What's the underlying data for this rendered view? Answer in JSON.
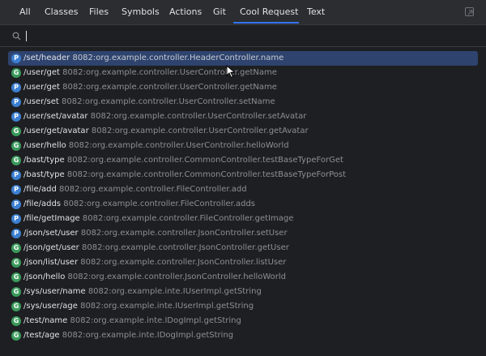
{
  "tabs": [
    {
      "label": "All"
    },
    {
      "label": "Classes"
    },
    {
      "label": "Files"
    },
    {
      "label": "Symbols"
    },
    {
      "label": "Actions"
    },
    {
      "label": "Git"
    },
    {
      "label": "Cool Request"
    },
    {
      "label": "Text"
    }
  ],
  "active_tab": "Cool Request",
  "search": {
    "value": "",
    "placeholder": ""
  },
  "selected_index": 0,
  "colors": {
    "accent": "#3574f0",
    "selection": "#2e436e",
    "post_badge": "#3c7fd1",
    "get_badge": "#3a9a5b"
  },
  "results": [
    {
      "method": "P",
      "path": "/set/header",
      "detail": "8082:org.example.controller.HeaderController.name"
    },
    {
      "method": "G",
      "path": "/user/get",
      "detail": "8082:org.example.controller.UserController.getName"
    },
    {
      "method": "P",
      "path": "/user/get",
      "detail": "8082:org.example.controller.UserController.getName"
    },
    {
      "method": "P",
      "path": "/user/set",
      "detail": "8082:org.example.controller.UserController.setName"
    },
    {
      "method": "P",
      "path": "/user/set/avatar",
      "detail": "8082:org.example.controller.UserController.setAvatar"
    },
    {
      "method": "G",
      "path": "/user/get/avatar",
      "detail": "8082:org.example.controller.UserController.getAvatar"
    },
    {
      "method": "G",
      "path": "/user/hello",
      "detail": "8082:org.example.controller.UserController.helloWorld"
    },
    {
      "method": "G",
      "path": "/bast/type",
      "detail": "8082:org.example.controller.CommonController.testBaseTypeForGet"
    },
    {
      "method": "P",
      "path": "/bast/type",
      "detail": "8082:org.example.controller.CommonController.testBaseTypeForPost"
    },
    {
      "method": "P",
      "path": "/file/add",
      "detail": "8082:org.example.controller.FileController.add"
    },
    {
      "method": "P",
      "path": "/file/adds",
      "detail": "8082:org.example.controller.FileController.adds"
    },
    {
      "method": "P",
      "path": "/file/getImage",
      "detail": "8082:org.example.controller.FileController.getImage"
    },
    {
      "method": "P",
      "path": "/json/set/user",
      "detail": "8082:org.example.controller.JsonController.setUser"
    },
    {
      "method": "G",
      "path": "/json/get/user",
      "detail": "8082:org.example.controller.JsonController.getUser"
    },
    {
      "method": "G",
      "path": "/json/list/user",
      "detail": "8082:org.example.controller.JsonController.listUser"
    },
    {
      "method": "G",
      "path": "/json/hello",
      "detail": "8082:org.example.controller.JsonController.helloWorld"
    },
    {
      "method": "G",
      "path": "/sys/user/name",
      "detail": "8082:org.example.inte.IUserImpl.getString"
    },
    {
      "method": "G",
      "path": "/sys/user/age",
      "detail": "8082:org.example.inte.IUserImpl.getString"
    },
    {
      "method": "G",
      "path": "/test/name",
      "detail": "8082:org.example.inte.IDogImpl.getString"
    },
    {
      "method": "G",
      "path": "/test/age",
      "detail": "8082:org.example.inte.IDogImpl.getString"
    }
  ]
}
